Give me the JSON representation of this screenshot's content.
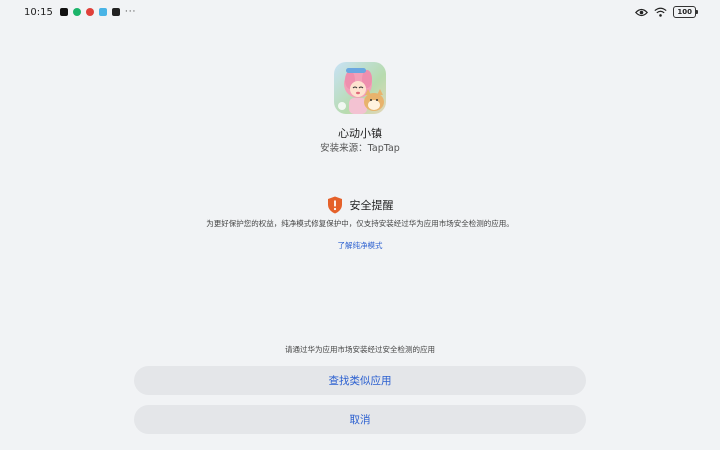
{
  "status_bar": {
    "time": "10:15",
    "overflow": "···",
    "battery": "100",
    "notification_colors": [
      "#111111",
      "#1bb46a",
      "#e0403a",
      "#49b4e6",
      "#222222"
    ]
  },
  "app": {
    "name": "心动小镇",
    "source": "安装来源：TapTap"
  },
  "warning": {
    "title": "安全提醒",
    "description": "为更好保护您的权益，纯净模式修复保护中，仅支持安装经过华为应用市场安全检测的应用。",
    "link": "了解纯净模式",
    "icon_color": "#e5612a"
  },
  "footer": {
    "note": "请通过华为应用市场安装经过安全检测的应用",
    "find_similar": "查找类似应用",
    "cancel": "取消",
    "accent": "#2a5fd0"
  }
}
